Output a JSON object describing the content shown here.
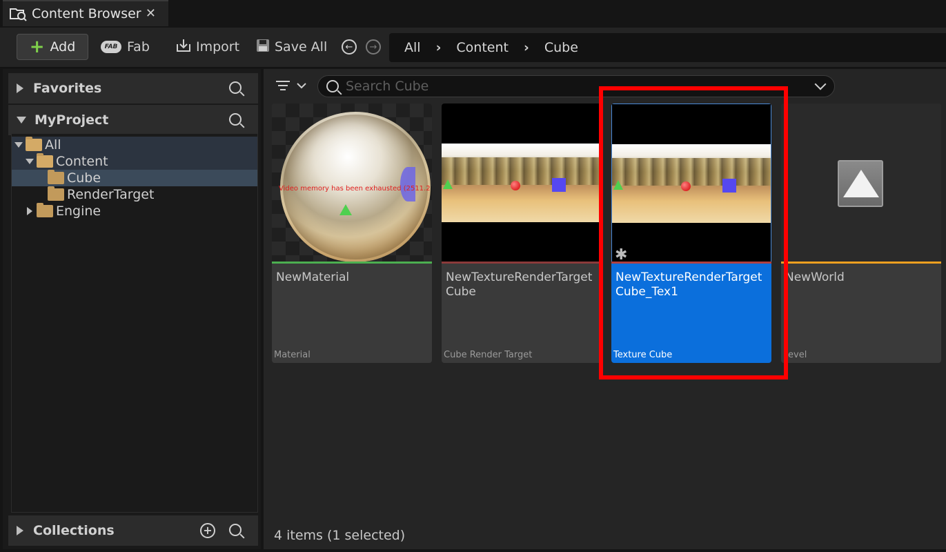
{
  "tab": {
    "title": "Content Browser",
    "close": "✕"
  },
  "toolbar": {
    "add_label": "Add",
    "fab_label": "Fab",
    "fab_logo": "FAB",
    "import_label": "Import",
    "save_all_label": "Save All"
  },
  "breadcrumb": {
    "items": [
      "All",
      "Content",
      "Cube"
    ],
    "separator": "›"
  },
  "left": {
    "favorites": "Favorites",
    "project": "MyProject",
    "tree": [
      "All",
      "Content",
      "Cube",
      "RenderTarget",
      "Engine"
    ],
    "collections": "Collections"
  },
  "search": {
    "placeholder": "Search Cube"
  },
  "assets": [
    {
      "name": "NewMaterial",
      "type": "Material",
      "bar_color": "#4caf50",
      "warning": "Video memory has been exhausted (2511.2"
    },
    {
      "name": "NewTextureRenderTarget Cube",
      "type": "Cube Render Target",
      "bar_color": "#8b3a3a"
    },
    {
      "name": "NewTextureRenderTarget Cube_Tex1",
      "type": "Texture Cube",
      "bar_color": "#b04040",
      "selected": true
    },
    {
      "name": "NewWorld",
      "type": "Level",
      "bar_color": "#f0a020"
    }
  ],
  "status": "4 items (1 selected)"
}
